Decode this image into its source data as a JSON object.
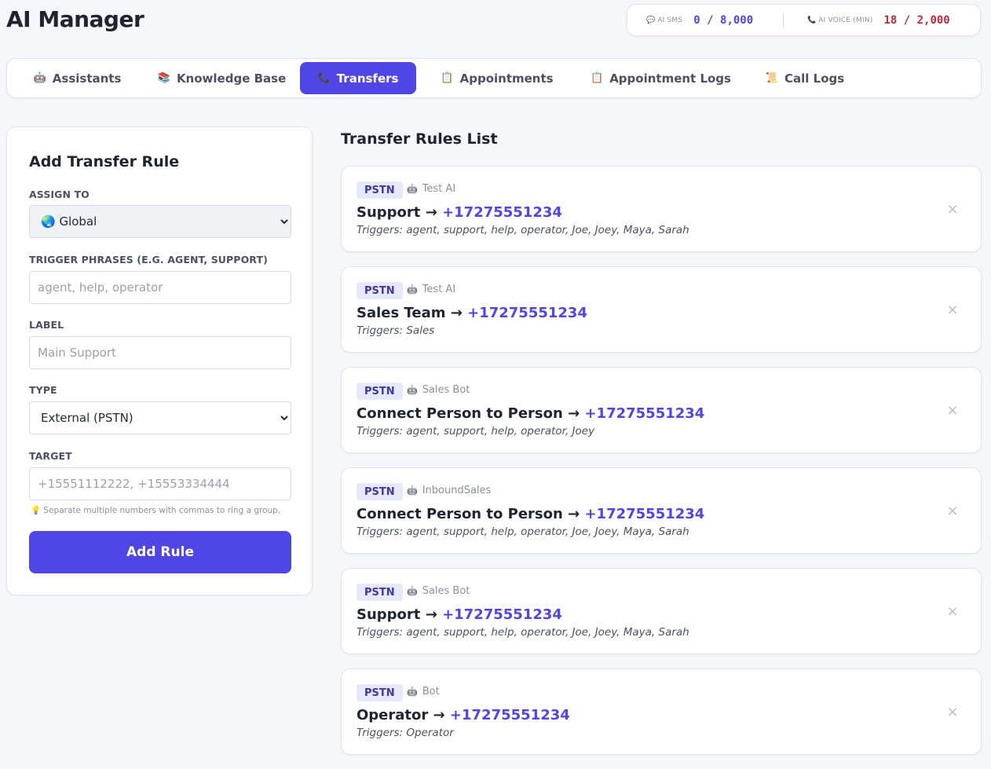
{
  "app": {
    "title": "AI Manager"
  },
  "usage": {
    "sms": {
      "icon": "speech-bubble-icon",
      "label": "AI SMS",
      "value": "0 / 8,000",
      "color": "#4f46e5"
    },
    "voice": {
      "icon": "phone-icon",
      "label": "AI VOICE (MIN)",
      "value": "18 / 2,000",
      "color": "#c0283c"
    }
  },
  "tabs": [
    {
      "icon": "robot-icon",
      "glyph": "🤖",
      "label": "Assistants",
      "active": false
    },
    {
      "icon": "books-icon",
      "glyph": "📚",
      "label": "Knowledge Base",
      "active": false
    },
    {
      "icon": "phone-icon",
      "glyph": "📞",
      "label": "Transfers",
      "active": true
    },
    {
      "icon": "clipboard-icon",
      "glyph": "📋",
      "label": "Appointments",
      "active": false
    },
    {
      "icon": "clipboard-icon",
      "glyph": "📋",
      "label": "Appointment Logs",
      "active": false
    },
    {
      "icon": "scroll-icon",
      "glyph": "📜",
      "label": "Call Logs",
      "active": false
    }
  ],
  "form": {
    "title": "Add Transfer Rule",
    "assign_label": "Assign To",
    "assign_value": "🌏 Global",
    "trigger_label": "Trigger Phrases (e.g. agent, support)",
    "trigger_placeholder": "agent, help, operator",
    "label_label": "Label",
    "label_placeholder": "Main Support",
    "type_label": "Type",
    "type_value": "External (PSTN)",
    "target_label": "Target",
    "target_placeholder": "+15551112222, +15553334444",
    "hint": "💡 Separate multiple numbers with commas to ring a group.",
    "submit_label": "Add Rule"
  },
  "rules_list": {
    "title": "Transfer Rules List",
    "arrow": "→",
    "triggers_prefix": "Triggers:",
    "close_glyph": "×",
    "rules": [
      {
        "badge": "PSTN",
        "assistant": "Test AI",
        "label": "Support",
        "target": "+17275551234",
        "triggers": "agent, support, help, operator, Joe, Joey, Maya, Sarah"
      },
      {
        "badge": "PSTN",
        "assistant": "Test AI",
        "label": "Sales Team",
        "target": "+17275551234",
        "triggers": "Sales"
      },
      {
        "badge": "PSTN",
        "assistant": "Sales Bot",
        "label": "Connect Person to Person",
        "target": "+17275551234",
        "triggers": "agent, support, help, operator, Joey"
      },
      {
        "badge": "PSTN",
        "assistant": "InboundSales",
        "label": "Connect Person to Person",
        "target": "+17275551234",
        "triggers": "agent, support, help, operator, Joe, Joey, Maya, Sarah"
      },
      {
        "badge": "PSTN",
        "assistant": "Sales Bot",
        "label": "Support",
        "target": "+17275551234",
        "triggers": "agent, support, help, operator, Joe, Joey, Maya, Sarah"
      },
      {
        "badge": "PSTN",
        "assistant": "Bot",
        "label": "Operator",
        "target": "+17275551234",
        "triggers": "Operator"
      }
    ]
  }
}
